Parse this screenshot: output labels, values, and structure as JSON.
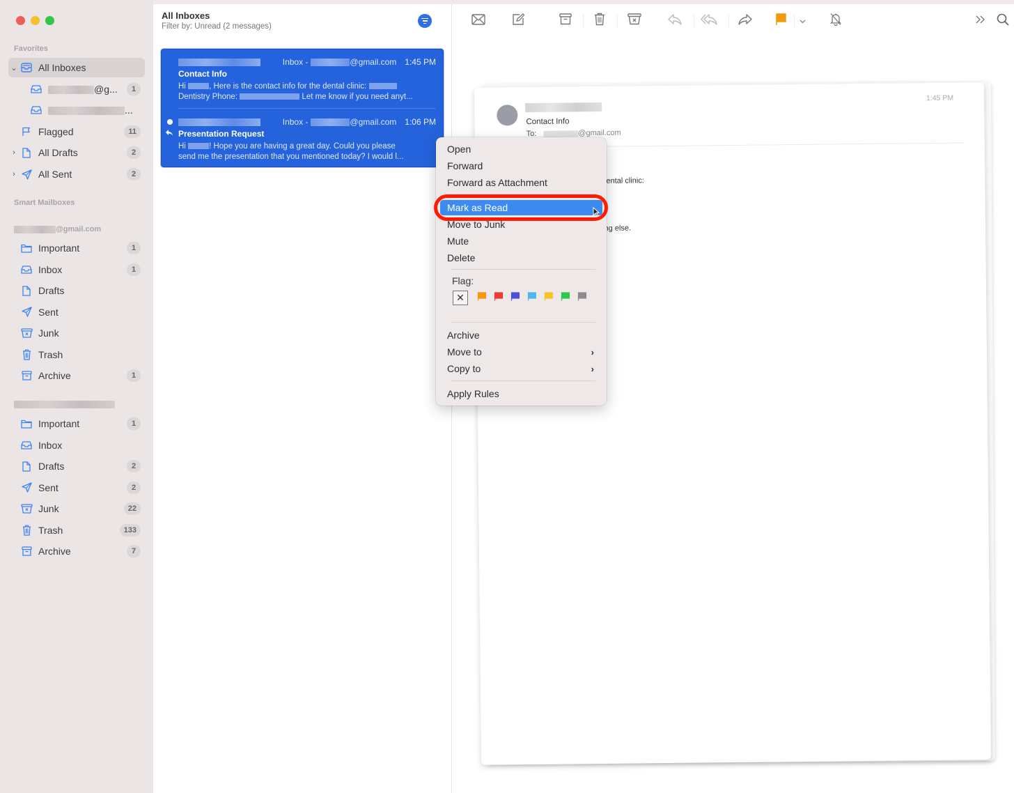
{
  "window": {
    "traffic_lights": [
      "close",
      "minimize",
      "zoom"
    ]
  },
  "sidebar": {
    "favorites_heading": "Favorites",
    "favorites": [
      {
        "label": "All Inboxes",
        "icon": "inbox-stack-icon",
        "disclosure": "expanded",
        "selected": true,
        "badge": ""
      },
      {
        "label": "@g...",
        "icon": "inbox-tray-icon",
        "redacted_prefix": true,
        "badge": "1",
        "child": true
      },
      {
        "label": "...",
        "icon": "inbox-tray-icon",
        "redacted_prefix": true,
        "badge": "",
        "child": true
      },
      {
        "label": "Flagged",
        "icon": "flag-icon",
        "badge": "11"
      },
      {
        "label": "All Drafts",
        "icon": "draft-doc-icon",
        "disclosure": "collapsed",
        "badge": "2"
      },
      {
        "label": "All Sent",
        "icon": "paper-plane-icon",
        "disclosure": "collapsed",
        "badge": "2"
      }
    ],
    "smart_heading": "Smart Mailboxes",
    "account1": {
      "label": "@gmail.com",
      "items": [
        {
          "label": "Important",
          "icon": "folder-icon",
          "badge": "1"
        },
        {
          "label": "Inbox",
          "icon": "inbox-tray-icon",
          "badge": "1"
        },
        {
          "label": "Drafts",
          "icon": "draft-doc-icon",
          "badge": ""
        },
        {
          "label": "Sent",
          "icon": "paper-plane-icon",
          "badge": ""
        },
        {
          "label": "Junk",
          "icon": "junk-box-icon",
          "badge": ""
        },
        {
          "label": "Trash",
          "icon": "trash-icon",
          "badge": ""
        },
        {
          "label": "Archive",
          "icon": "archive-box-icon",
          "badge": "1"
        }
      ]
    },
    "account2": {
      "label": "",
      "items": [
        {
          "label": "Important",
          "icon": "folder-icon",
          "badge": "1"
        },
        {
          "label": "Inbox",
          "icon": "inbox-tray-icon",
          "badge": ""
        },
        {
          "label": "Drafts",
          "icon": "draft-doc-icon",
          "badge": "2"
        },
        {
          "label": "Sent",
          "icon": "paper-plane-icon",
          "badge": "2"
        },
        {
          "label": "Junk",
          "icon": "junk-box-icon",
          "badge": "22"
        },
        {
          "label": "Trash",
          "icon": "trash-icon",
          "badge": "133"
        },
        {
          "label": "Archive",
          "icon": "archive-box-icon",
          "badge": "7"
        }
      ]
    }
  },
  "list": {
    "title": "All Inboxes",
    "subtitle": "Filter by: Unread (2 messages)",
    "messages": [
      {
        "mailbox_prefix": "Inbox -",
        "mailbox_suffix": "@gmail.com",
        "time": "1:45 PM",
        "subject": "Contact Info",
        "preview_a": "Hi",
        "preview_b": ", Here is the contact info for the dental clinic:",
        "preview_c": "Dentistry Phone:",
        "preview_d": "Let me know if you need anyt...",
        "unread": false,
        "replied": false
      },
      {
        "mailbox_prefix": "Inbox -",
        "mailbox_suffix": "@gmail.com",
        "time": "1:06 PM",
        "subject": "Presentation Request",
        "preview_a": "Hi",
        "preview_b": "! Hope you are having a great day. Could you please",
        "preview_c": "send me the presentation that you mentioned today? I would l...",
        "unread": true,
        "replied": true
      }
    ]
  },
  "toolbar": {
    "buttons": [
      {
        "name": "get-mail",
        "icon": "envelope-icon"
      },
      {
        "name": "compose",
        "icon": "compose-icon"
      },
      {
        "name": "archive",
        "icon": "archive-box-icon"
      },
      {
        "name": "delete",
        "icon": "trash-icon"
      },
      {
        "name": "junk",
        "icon": "junk-box-icon"
      },
      {
        "name": "reply",
        "icon": "reply-icon"
      },
      {
        "name": "reply-all",
        "icon": "reply-all-icon"
      },
      {
        "name": "forward",
        "icon": "forward-icon"
      },
      {
        "name": "flag",
        "icon": "flag-icon",
        "color": "#f29a0f"
      },
      {
        "name": "flag-menu",
        "icon": "chevron-down-icon"
      },
      {
        "name": "mute",
        "icon": "bell-slash-icon"
      },
      {
        "name": "more",
        "icon": "double-chevron-right-icon"
      },
      {
        "name": "search",
        "icon": "search-icon"
      }
    ]
  },
  "viewer": {
    "subject": "Contact Info",
    "to_label": "To:",
    "to_suffix": "@gmail.com",
    "time": "1:45 PM",
    "body_fragment_1": "dental clinic:",
    "body_fragment_2": "ing else."
  },
  "context_menu": {
    "group1": [
      "Open",
      "Forward",
      "Forward as Attachment"
    ],
    "group2": [
      "Mark as Read",
      "Move to Junk",
      "Mute",
      "Delete"
    ],
    "highlighted": "Mark as Read",
    "flag_label": "Flag:",
    "flag_colors": [
      {
        "name": "orange",
        "hex": "#f7950d"
      },
      {
        "name": "red",
        "hex": "#f03a2f"
      },
      {
        "name": "purple",
        "hex": "#4d4fd6"
      },
      {
        "name": "blue",
        "hex": "#4fb6ee"
      },
      {
        "name": "yellow",
        "hex": "#f7c52b"
      },
      {
        "name": "green",
        "hex": "#2fc84a"
      },
      {
        "name": "gray",
        "hex": "#8c8c8c"
      }
    ],
    "group3": [
      {
        "label": "Archive",
        "submenu": false
      },
      {
        "label": "Move to",
        "submenu": true
      },
      {
        "label": "Copy to",
        "submenu": true
      }
    ],
    "group4": [
      "Apply Rules"
    ],
    "submenu_glyph": "›"
  },
  "annotation": {
    "highlight_color": "#ff1a00"
  }
}
